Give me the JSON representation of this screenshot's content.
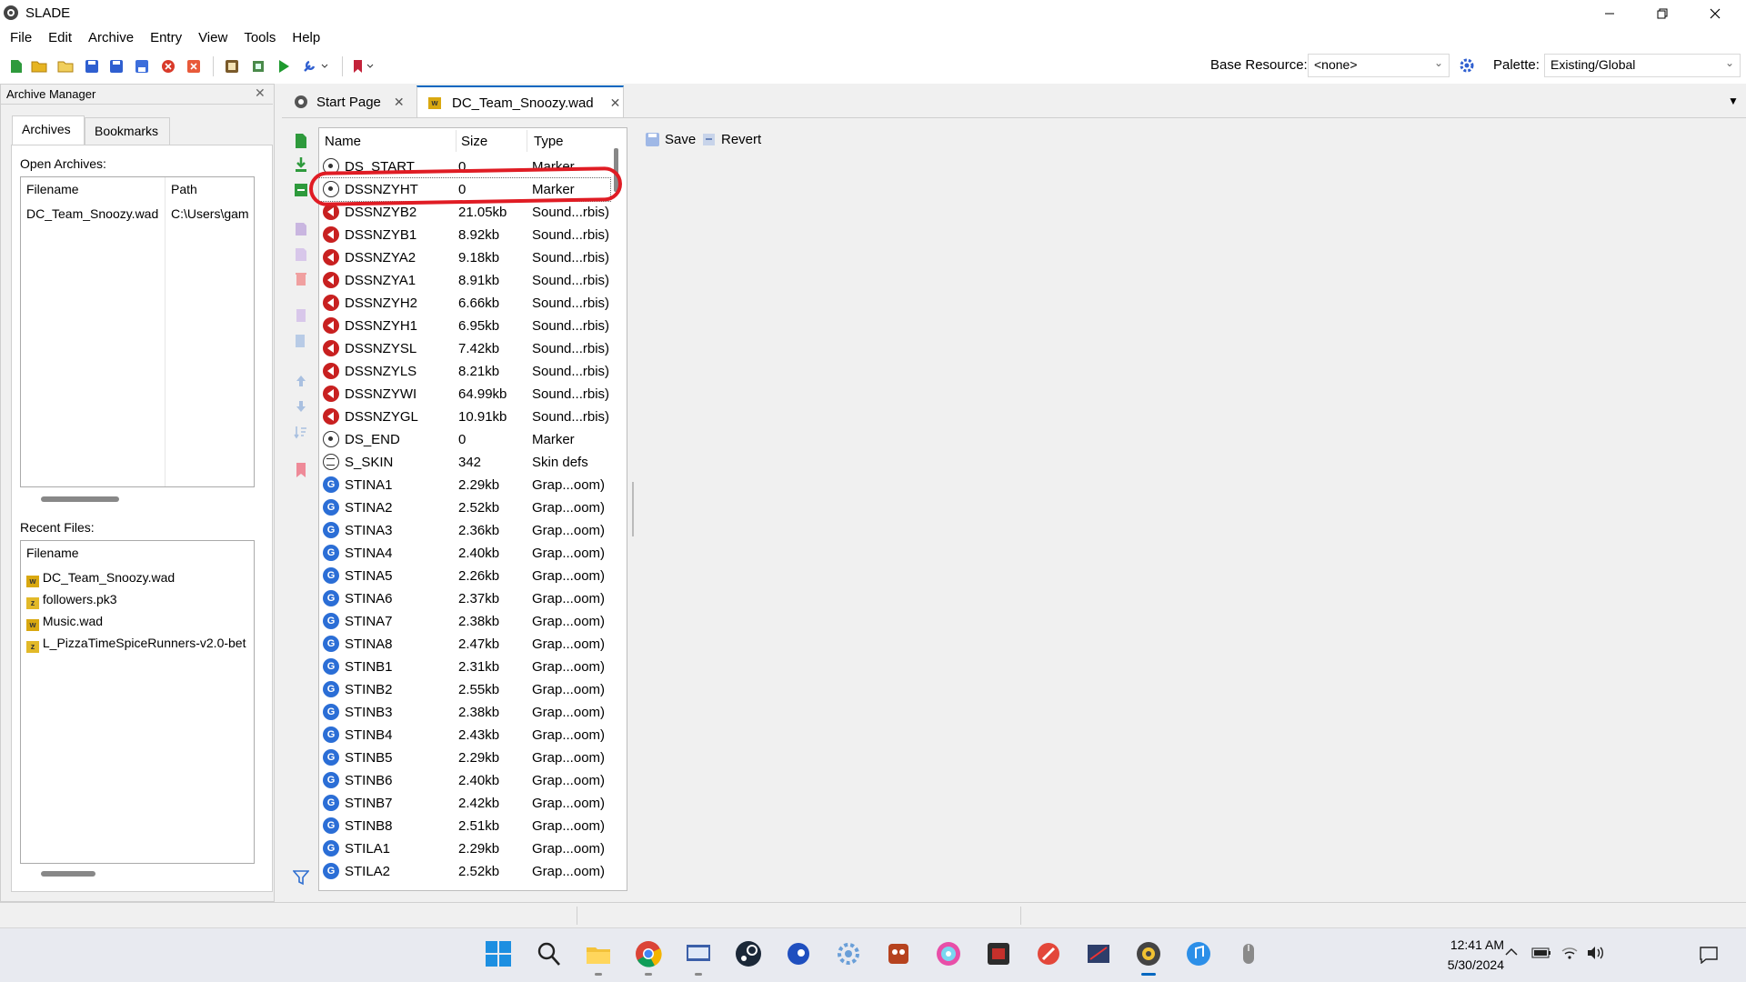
{
  "window": {
    "title": "SLADE"
  },
  "menu": [
    "File",
    "Edit",
    "Archive",
    "Entry",
    "View",
    "Tools",
    "Help"
  ],
  "toolbar": {
    "base_resource_label": "Base Resource:",
    "base_resource_value": "<none>",
    "palette_label": "Palette:",
    "palette_value": "Existing/Global"
  },
  "archive_manager": {
    "title": "Archive Manager",
    "tabs": [
      "Archives",
      "Bookmarks"
    ],
    "open_archives_label": "Open Archives:",
    "open_archives_columns": [
      "Filename",
      "Path"
    ],
    "open_archives": [
      {
        "filename": "DC_Team_Snoozy.wad",
        "path": "C:\\Users\\gam"
      }
    ],
    "recent_files_label": "Recent Files:",
    "recent_files_column": "Filename",
    "recent_files": [
      {
        "name": "DC_Team_Snoozy.wad",
        "icon": "wad-icon"
      },
      {
        "name": "followers.pk3",
        "icon": "zip-icon"
      },
      {
        "name": "Music.wad",
        "icon": "wad-icon"
      },
      {
        "name": "L_PizzaTimeSpiceRunners-v2.0-bet",
        "icon": "zip-icon"
      }
    ]
  },
  "doc_tabs": [
    "Start Page",
    "DC_Team_Snoozy.wad"
  ],
  "entry_actions": {
    "save": "Save",
    "revert": "Revert"
  },
  "entry_list": {
    "columns": [
      "Name",
      "Size",
      "Type"
    ],
    "entries": [
      {
        "name": "DS_START",
        "size": "0",
        "type": "Marker",
        "icon": "marker"
      },
      {
        "name": "DSSNZYHT",
        "size": "0",
        "type": "Marker",
        "icon": "marker"
      },
      {
        "name": "DSSNZYB2",
        "size": "21.05kb",
        "type": "Sound...rbis)",
        "icon": "sound"
      },
      {
        "name": "DSSNZYB1",
        "size": "8.92kb",
        "type": "Sound...rbis)",
        "icon": "sound"
      },
      {
        "name": "DSSNZYA2",
        "size": "9.18kb",
        "type": "Sound...rbis)",
        "icon": "sound"
      },
      {
        "name": "DSSNZYA1",
        "size": "8.91kb",
        "type": "Sound...rbis)",
        "icon": "sound"
      },
      {
        "name": "DSSNZYH2",
        "size": "6.66kb",
        "type": "Sound...rbis)",
        "icon": "sound"
      },
      {
        "name": "DSSNZYH1",
        "size": "6.95kb",
        "type": "Sound...rbis)",
        "icon": "sound"
      },
      {
        "name": "DSSNZYSL",
        "size": "7.42kb",
        "type": "Sound...rbis)",
        "icon": "sound"
      },
      {
        "name": "DSSNZYLS",
        "size": "8.21kb",
        "type": "Sound...rbis)",
        "icon": "sound"
      },
      {
        "name": "DSSNZYWI",
        "size": "64.99kb",
        "type": "Sound...rbis)",
        "icon": "sound"
      },
      {
        "name": "DSSNZYGL",
        "size": "10.91kb",
        "type": "Sound...rbis)",
        "icon": "sound"
      },
      {
        "name": "DS_END",
        "size": "0",
        "type": "Marker",
        "icon": "marker"
      },
      {
        "name": "S_SKIN",
        "size": "342",
        "type": "Skin defs",
        "icon": "text"
      },
      {
        "name": "STINA1",
        "size": "2.29kb",
        "type": "Grap...oom)",
        "icon": "gfx"
      },
      {
        "name": "STINA2",
        "size": "2.52kb",
        "type": "Grap...oom)",
        "icon": "gfx"
      },
      {
        "name": "STINA3",
        "size": "2.36kb",
        "type": "Grap...oom)",
        "icon": "gfx"
      },
      {
        "name": "STINA4",
        "size": "2.40kb",
        "type": "Grap...oom)",
        "icon": "gfx"
      },
      {
        "name": "STINA5",
        "size": "2.26kb",
        "type": "Grap...oom)",
        "icon": "gfx"
      },
      {
        "name": "STINA6",
        "size": "2.37kb",
        "type": "Grap...oom)",
        "icon": "gfx"
      },
      {
        "name": "STINA7",
        "size": "2.38kb",
        "type": "Grap...oom)",
        "icon": "gfx"
      },
      {
        "name": "STINA8",
        "size": "2.47kb",
        "type": "Grap...oom)",
        "icon": "gfx"
      },
      {
        "name": "STINB1",
        "size": "2.31kb",
        "type": "Grap...oom)",
        "icon": "gfx"
      },
      {
        "name": "STINB2",
        "size": "2.55kb",
        "type": "Grap...oom)",
        "icon": "gfx"
      },
      {
        "name": "STINB3",
        "size": "2.38kb",
        "type": "Grap...oom)",
        "icon": "gfx"
      },
      {
        "name": "STINB4",
        "size": "2.43kb",
        "type": "Grap...oom)",
        "icon": "gfx"
      },
      {
        "name": "STINB5",
        "size": "2.29kb",
        "type": "Grap...oom)",
        "icon": "gfx"
      },
      {
        "name": "STINB6",
        "size": "2.40kb",
        "type": "Grap...oom)",
        "icon": "gfx"
      },
      {
        "name": "STINB7",
        "size": "2.42kb",
        "type": "Grap...oom)",
        "icon": "gfx"
      },
      {
        "name": "STINB8",
        "size": "2.51kb",
        "type": "Grap...oom)",
        "icon": "gfx"
      },
      {
        "name": "STILA1",
        "size": "2.29kb",
        "type": "Grap...oom)",
        "icon": "gfx"
      },
      {
        "name": "STILA2",
        "size": "2.52kb",
        "type": "Grap...oom)",
        "icon": "gfx"
      }
    ]
  },
  "taskbar": {
    "clock_time": "12:41 AM",
    "clock_date": "5/30/2024"
  },
  "colors": {
    "accent": "#0067c0",
    "highlight_annotation": "#e01c24",
    "sound_icon": "#c82020",
    "graphic_icon": "#2b6ed6"
  }
}
